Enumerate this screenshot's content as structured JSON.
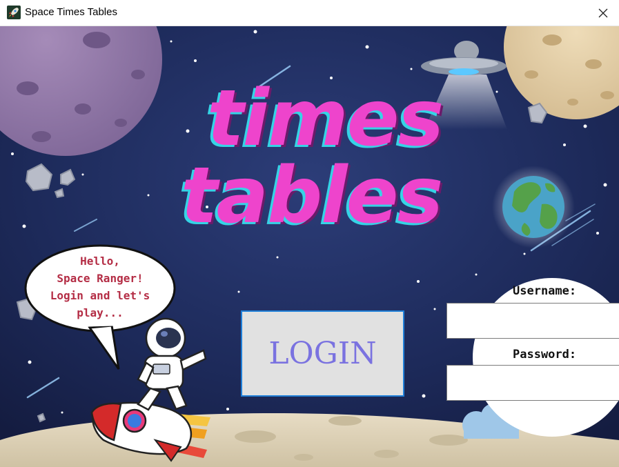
{
  "window": {
    "title": "Space Times Tables",
    "icons": {
      "app": "rocket-icon",
      "close": "close-icon"
    }
  },
  "banner": {
    "line1": "times",
    "line2": "tables"
  },
  "speech_bubble": {
    "lines": [
      "Hello,",
      "Space Ranger!",
      "Login and let's",
      "play..."
    ]
  },
  "login": {
    "button_label": "LOGIN",
    "username_label": "Username:",
    "username_value": "",
    "password_label": "Password:",
    "password_value": ""
  },
  "colors": {
    "title_pink": "#ee44cc",
    "title_cyan": "#35d4e6",
    "button_border": "#1f7fd8",
    "button_text": "#7a72e0",
    "bubble_text": "#b42d45",
    "space_bg": "#1b2650"
  }
}
